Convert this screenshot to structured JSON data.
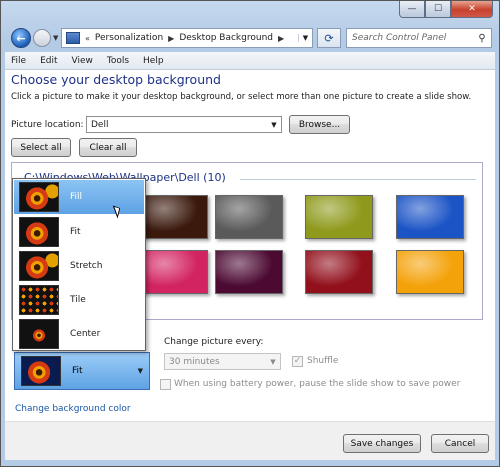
{
  "window": {
    "caption_buttons": [
      "minimize-icon",
      "maximize-icon",
      "close-icon"
    ]
  },
  "nav": {
    "breadcrumbs": [
      "Personalization",
      "Desktop Background"
    ],
    "search_placeholder": "Search Control Panel"
  },
  "menu": {
    "items": [
      "File",
      "Edit",
      "View",
      "Tools",
      "Help"
    ]
  },
  "main": {
    "heading": "Choose your desktop background",
    "subtext": "Click a picture to make it your desktop background, or select more than one picture to create a slide show.",
    "location_label": "Picture location:",
    "location_value": "Dell",
    "browse": "Browse...",
    "select_all": "Select all",
    "clear_all": "Clear all",
    "folder": "C:\\Windows\\Web\\Wallpaper\\Dell (10)"
  },
  "thumbnails": [
    {
      "color": "#3b1a0d"
    },
    {
      "color": "#5a5a5a"
    },
    {
      "color": "#8f9a1c"
    },
    {
      "color": "#1c54c6"
    },
    {
      "color": "#d32462"
    },
    {
      "color": "#4c0a33"
    },
    {
      "color": "#92101c"
    },
    {
      "color": "#f4a20a"
    }
  ],
  "position_menu": {
    "options": [
      "Fill",
      "Fit",
      "Stretch",
      "Tile",
      "Center"
    ],
    "selected": "Fill"
  },
  "picture_position": {
    "value": "Fit"
  },
  "slideshow": {
    "change_label": "Change picture every:",
    "interval": "30 minutes",
    "shuffle": "Shuffle",
    "battery": "When using battery power, pause the slide show to save power"
  },
  "links": {
    "change_color": "Change background color"
  },
  "buttons": {
    "save": "Save changes",
    "cancel": "Cancel"
  }
}
